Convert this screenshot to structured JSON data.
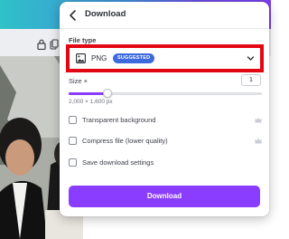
{
  "panel": {
    "title": "Download",
    "back_icon": "chevron-left-icon"
  },
  "file_type": {
    "label": "File type",
    "value": "PNG",
    "badge": "SUGGESTED",
    "icon": "image-icon",
    "dropdown_icon": "chevron-down-icon",
    "highlight_color": "#e30613"
  },
  "size": {
    "label": "Size ×",
    "value": "1",
    "slider_fraction": 0.2,
    "dimensions": "2,000 × 1,600 px"
  },
  "options": [
    {
      "label": "Transparent background",
      "checked": false,
      "premium": true
    },
    {
      "label": "Compress file (lower quality)",
      "checked": false,
      "premium": true
    },
    {
      "label": "Save download settings",
      "checked": false,
      "premium": false
    }
  ],
  "download_button": {
    "label": "Download"
  },
  "colors": {
    "accent": "#8b3dff",
    "badge": "#3d6bde"
  }
}
